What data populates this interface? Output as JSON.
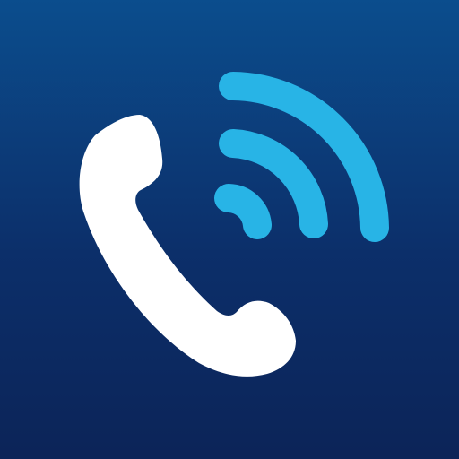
{
  "icon": {
    "handset": "phone-handset-icon",
    "signal": "signal-waves-icon"
  },
  "colors": {
    "background_top": "#0b4d8d",
    "background_bottom": "#0c2458",
    "handset": "#ffffff",
    "signal_waves": "#28b4e6"
  }
}
